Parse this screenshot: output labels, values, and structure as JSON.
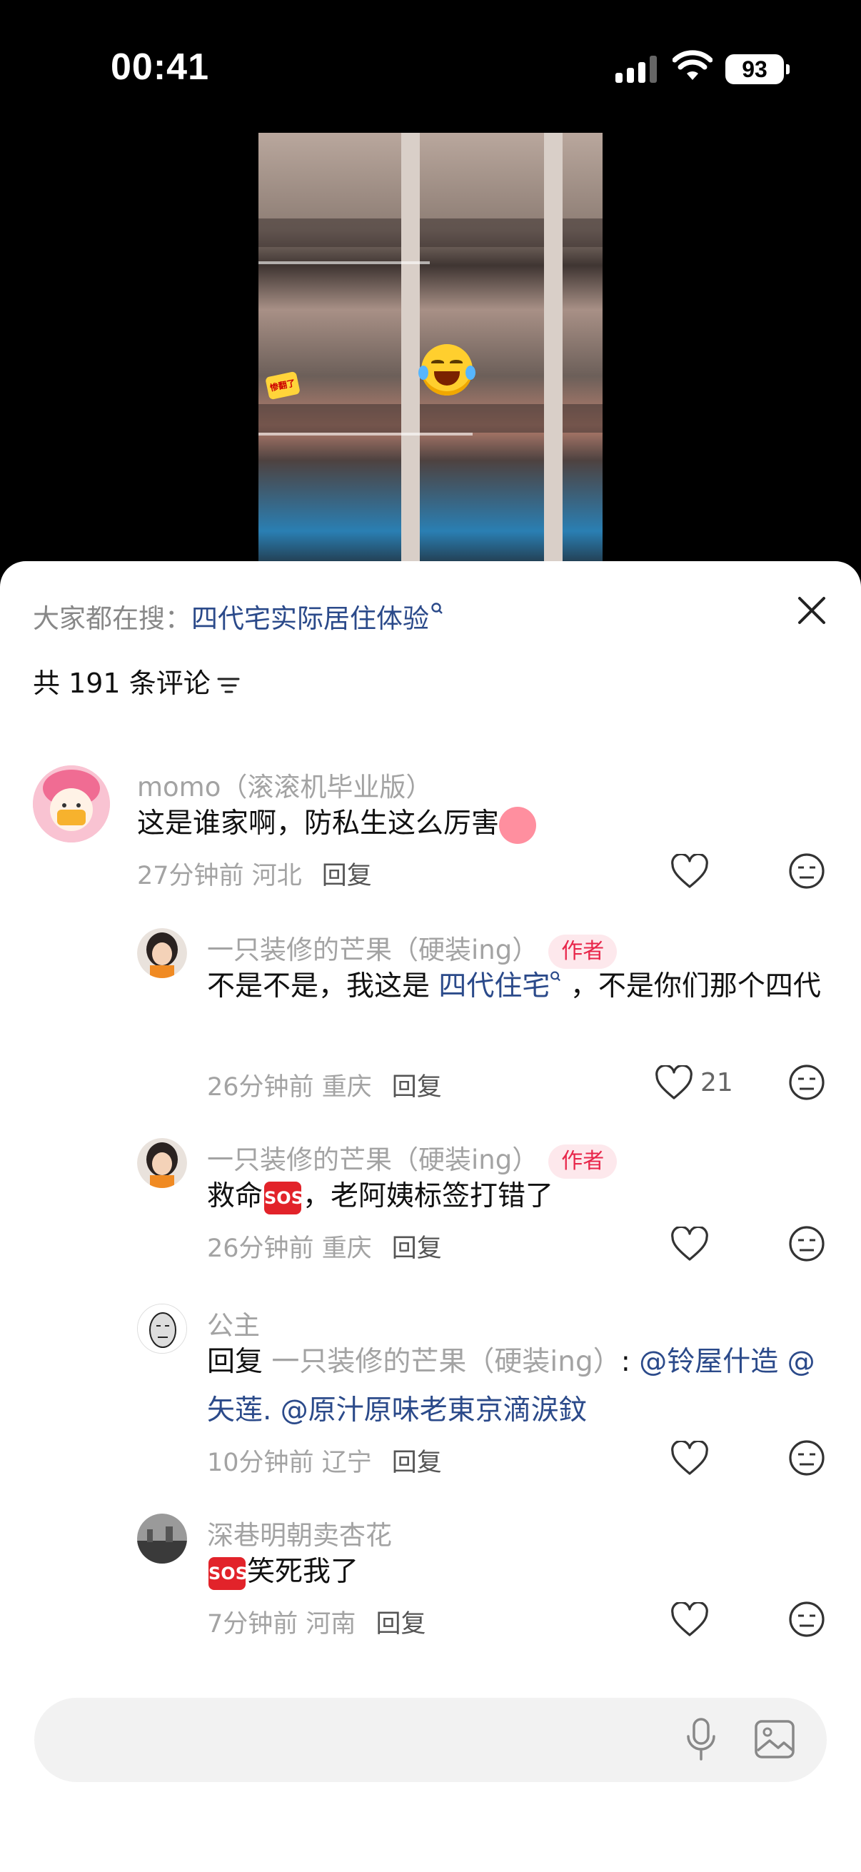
{
  "status": {
    "time": "00:41",
    "battery": "93"
  },
  "sticker": {
    "text": "惨翻了"
  },
  "sheet": {
    "search_prefix": "大家都在搜：",
    "search_keyword": "四代宅实际居住体验",
    "comment_count": "共 191 条评论"
  },
  "comments": [
    {
      "name": "momo（滚滚机毕业版）",
      "text": "这是谁家啊，防私生这么厉害",
      "time": "27分钟前",
      "location": "河北",
      "reply": "回复",
      "likes": ""
    },
    {
      "name": "一只装修的芒果（硬装ing）",
      "tag": "作者",
      "text_a": "不是不是，我这是 ",
      "link": "四代住宅",
      "text_b": " ，不是你们那个四代",
      "time": "26分钟前",
      "location": "重庆",
      "reply": "回复",
      "likes": "21"
    },
    {
      "name": "一只装修的芒果（硬装ing）",
      "tag": "作者",
      "text_a": "救命",
      "text_b": "，老阿姨标签打错了",
      "time": "26分钟前",
      "location": "重庆",
      "reply": "回复",
      "likes": ""
    },
    {
      "name": "公主",
      "prefix": "回复 ",
      "reply_to": "一只装修的芒果（硬装ing）",
      "colon": ": ",
      "mentions": "@铃屋什造 @矢莲. @原汁原味老東京滴涙鈫",
      "time": "10分钟前",
      "location": "辽宁",
      "reply": "回复",
      "likes": ""
    },
    {
      "name": "深巷明朝卖杏花",
      "text": "笑死我了",
      "time": "7分钟前",
      "location": "河南",
      "reply": "回复",
      "likes": ""
    }
  ],
  "sos_label": "SOS",
  "colors": {
    "link": "#2b4a8a",
    "tag": "#e8264a",
    "meta": "#a3a3a3"
  },
  "icons": [
    "signal-icon",
    "wifi-icon",
    "close-icon",
    "filter-icon",
    "heart-icon",
    "dislike-face-icon",
    "mic-icon",
    "image-icon"
  ]
}
